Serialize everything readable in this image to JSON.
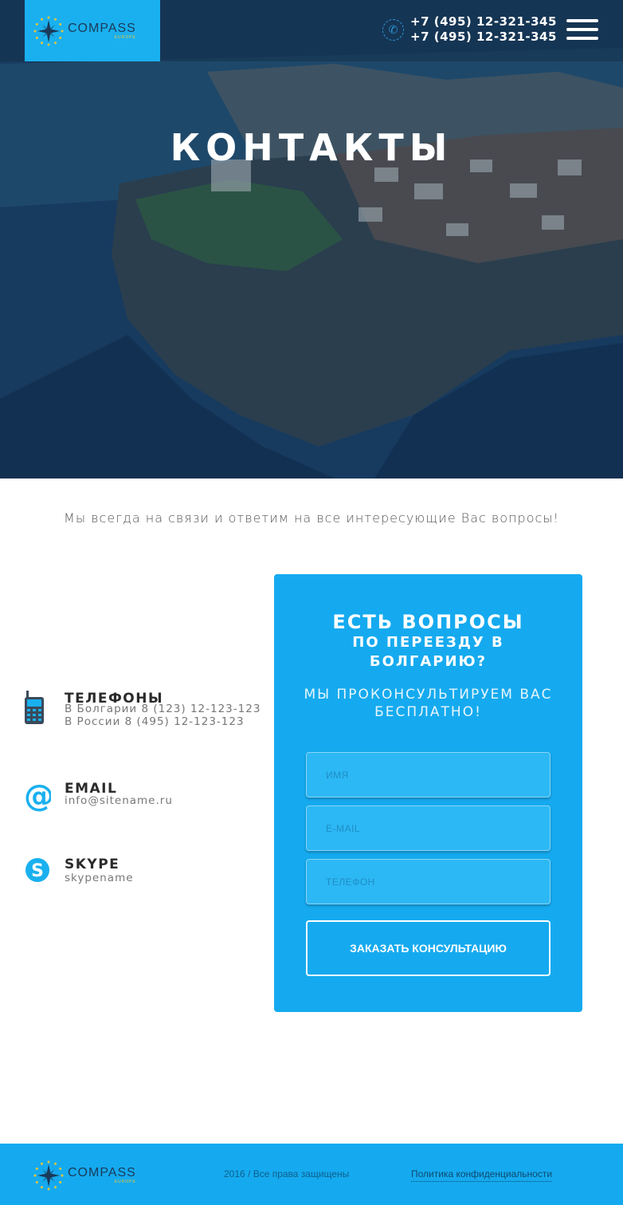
{
  "header": {
    "logo": {
      "name": "COMPASS",
      "sub": "EUROPE"
    },
    "phones": [
      "+7 (495) 12-321-345",
      "+7 (495) 12-321-345"
    ],
    "menu_icon": "hamburger-icon"
  },
  "hero": {
    "title": "КОНТАКТЫ"
  },
  "intro": "Мы всегда на связи и ответим на все интересующие Вас вопросы!",
  "contacts": {
    "phones": {
      "title": "ТЕЛЕФОНЫ",
      "lines": [
        "В Болгарии 8 (123) 12-123-123",
        "В России 8 (495) 12-123-123"
      ],
      "icon": "mobile-phone-icon"
    },
    "email": {
      "title": "EMAIL",
      "value": "info@sitename.ru",
      "icon": "at-sign-icon"
    },
    "skype": {
      "title": "SKYPE",
      "value": "skypename",
      "icon": "skype-icon"
    }
  },
  "form": {
    "title": "ЕСТЬ ВОПРОСЫ",
    "subtitle_line1": "ПО ПЕРЕЕЗДУ В",
    "subtitle_line2": "БОЛГАРИЮ?",
    "note_line1": "МЫ ПРОКОНСУЛЬТИРУЕМ ВАС",
    "note_line2": "БЕСПЛАТНО!",
    "name_placeholder": "ИМЯ",
    "email_placeholder": "E-MAIL",
    "phone_placeholder": "ТЕЛЕФОН",
    "submit_label": "ЗАКАЗАТЬ КОНСУЛЬТАЦИЮ"
  },
  "footer": {
    "logo": {
      "name": "COMPASS",
      "sub": "EUROPE"
    },
    "copyright": "2016 / Все права защищены",
    "policy_link": "Политика конфиденциальности"
  },
  "colors": {
    "accent": "#15aaef",
    "hero_overlay": "#143250"
  }
}
